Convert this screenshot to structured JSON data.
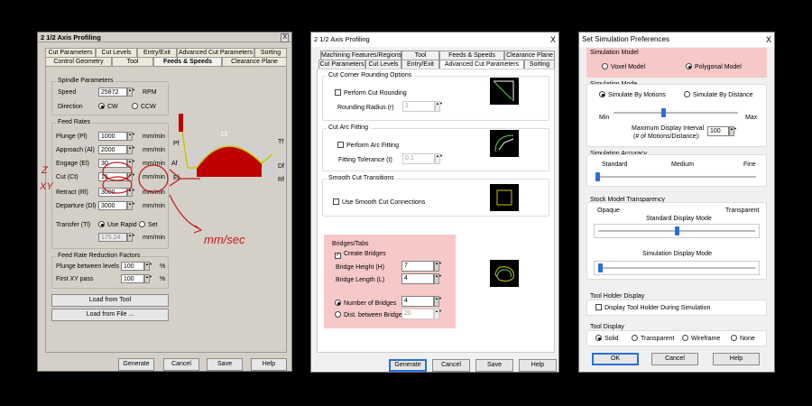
{
  "w1": {
    "title": "2 1/2 Axis Profiling",
    "close": "X",
    "tabs_row1": [
      "Cut Parameters",
      "Cut Levels",
      "Entry/Exit",
      "Advanced Cut Parameters",
      "Sorting"
    ],
    "tabs_row2": [
      "Control Geometry",
      "Tool",
      "Feeds & Speeds",
      "Clearance Plane"
    ],
    "spindle": {
      "title": "Spindle Parameters",
      "speed_label": "Speed",
      "speed_value": "25872",
      "speed_unit": "RPM",
      "direction_label": "Direction",
      "cw": "CW",
      "ccw": "CCW"
    },
    "feed": {
      "title": "Feed Rates",
      "rows": [
        {
          "label": "Plunge (Pl)",
          "value": "1000",
          "unit": "mm/min"
        },
        {
          "label": "Approach (Al)",
          "value": "2000",
          "unit": "mm/min"
        },
        {
          "label": "Engage (El)",
          "value": "30",
          "unit": "mm/min"
        },
        {
          "label": "Cut (Ct)",
          "value": "15",
          "unit": "mm/min"
        },
        {
          "label": "Retract (Rl)",
          "value": "3000",
          "unit": "mm/min"
        },
        {
          "label": "Departure (Dl)",
          "value": "3000",
          "unit": "mm/min"
        }
      ],
      "transfer_label": "Transfer (Tl)",
      "use_rapid": "Use Rapid",
      "set": "Set",
      "transfer_value": "175.24",
      "transfer_unit": "mm/min"
    },
    "reduction": {
      "title": "Feed Rate Reduction Factors",
      "plunge_label": "Plunge between levels",
      "plunge_value": "100",
      "first_label": "First XY pass",
      "first_value": "100",
      "unit": "%"
    },
    "load_tool": "Load from Tool",
    "load_file": "Load from File ...",
    "buttons": [
      "Generate",
      "Cancel",
      "Save",
      "Help"
    ],
    "diagram_labels": {
      "pf": "Pf",
      "cf": "Cf",
      "tf": "Tf",
      "af": "Af",
      "df": "Df",
      "ef": "Ef",
      "rf": "Rf"
    },
    "annotations": {
      "z": "Z",
      "xy": "XY",
      "units": "mm/sec"
    }
  },
  "w2": {
    "title": "2 1/2 Axis Profiling",
    "close": "X",
    "tabs_row1": [
      "Machining Features/Regions",
      "Tool",
      "Feeds & Speeds",
      "Clearance Plane"
    ],
    "tabs_row2": [
      "Cut Parameters",
      "Cut Levels",
      "Entry/Exit",
      "Advanced Cut Parameters",
      "Sorting"
    ],
    "corner": {
      "title": "Cut Corner Rounding Options",
      "perform": "Perform Cut Rounding",
      "radius_label": "Rounding Radius (r)",
      "radius_value": "1"
    },
    "arc": {
      "title": "Cut Arc Fitting",
      "perform": "Perform Arc Fitting",
      "tol_label": "Fitting Tolerance (t)",
      "tol_value": "0.1"
    },
    "smooth": {
      "title": "Smooth Cut Transitions",
      "use": "Use Smooth Cut Connections"
    },
    "bridges": {
      "title": "Bridges/Tabs",
      "create": "Create Bridges",
      "height_label": "Bridge Height (H)",
      "height_value": "7",
      "length_label": "Bridge Length (L)",
      "length_value": "4",
      "number_label": "Number of Bridges",
      "number_value": "4",
      "dist_label": "Dist. between Bridges",
      "dist_value": "20"
    },
    "buttons": [
      "Generate",
      "Cancel",
      "Save",
      "Help"
    ]
  },
  "w3": {
    "title": "Set Simulation Preferences",
    "close": "X",
    "sim_model": {
      "title": "Simulation Model",
      "voxel": "Voxel Model",
      "polygonal": "Polygonal Model"
    },
    "sim_mode": {
      "title": "Simulation Mode",
      "motions": "Simulate By Motions",
      "distance": "Simulate By Distance",
      "min": "Min",
      "max": "Max",
      "interval_label": "Maximum Display Interval",
      "interval_label2": "(# of Motions/Distance):",
      "interval_value": "100",
      "slider_level": 0.4
    },
    "accuracy": {
      "title": "Simulation Accuracy",
      "standard": "Standard",
      "medium": "Medium",
      "fine": "Fine",
      "slider_level": 0.0
    },
    "transparency": {
      "title": "Stock Model Transparency",
      "opaque": "Opaque",
      "transparent": "Transparent",
      "standard_mode": "Standard Display Mode",
      "sim_mode": "Simulation Display Mode",
      "standard_level": 0.5,
      "sim_level": 0.0
    },
    "holder": {
      "title": "Tool Holder Display",
      "display": "Display Tool Holder During Simulation"
    },
    "tool_display": {
      "title": "Tool Display",
      "solid": "Solid",
      "transparent": "Transparent",
      "wireframe": "Wireframe",
      "none": "None"
    },
    "buttons": [
      "OK",
      "Cancel",
      "Help"
    ]
  },
  "colors": {
    "accent": "#2a6fd6",
    "highlight": "#f7c8c8",
    "annotation": "#c01818",
    "dialog_classic": "#d4d0c8",
    "dialog_modern": "#f0f0f0"
  }
}
